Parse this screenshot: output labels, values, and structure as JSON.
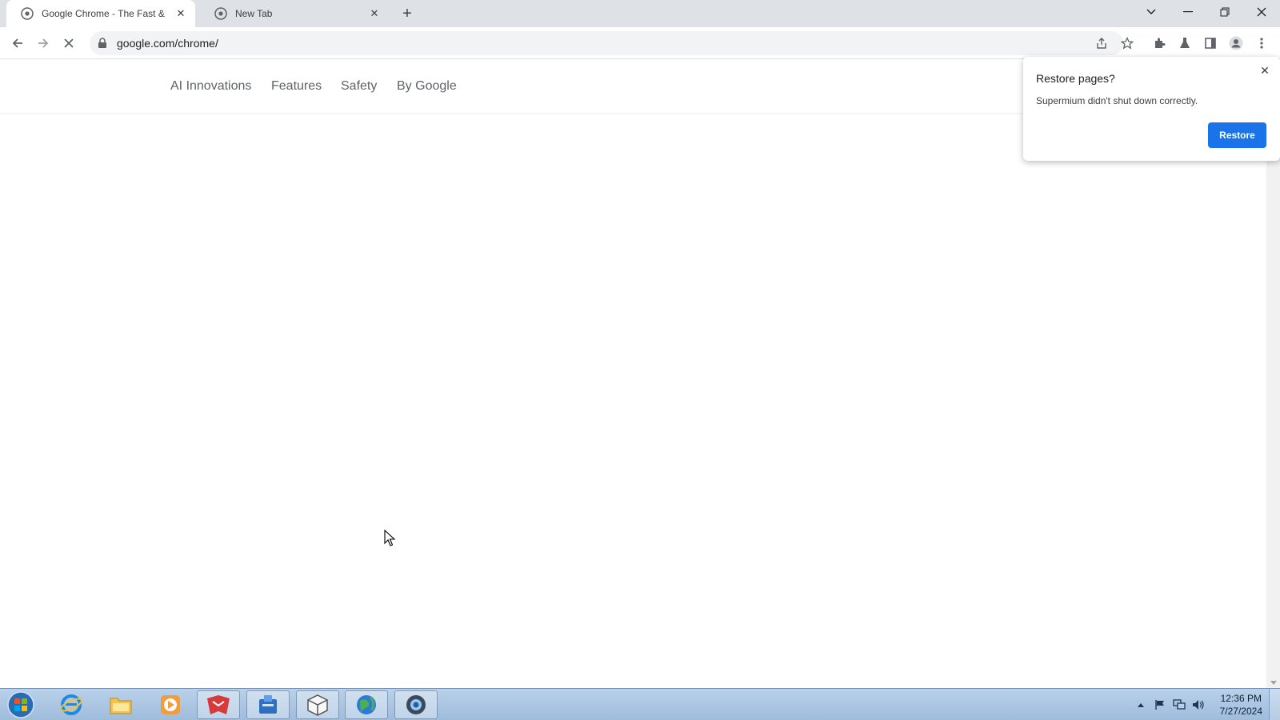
{
  "tabs": [
    {
      "title": "Google Chrome - The Fast & Se",
      "favicon": "chrome-icon",
      "active": true
    },
    {
      "title": "New Tab",
      "favicon": "chrome-icon",
      "active": false
    }
  ],
  "window_controls": [
    "tab-search-icon",
    "minimize-icon",
    "restore-icon",
    "close-icon"
  ],
  "address_bar": {
    "url": "google.com/chrome/"
  },
  "site_nav": {
    "links": [
      "AI Innovations",
      "Features",
      "Safety",
      "By Google"
    ]
  },
  "restore_bubble": {
    "title": "Restore pages?",
    "message": "Supermium didn't shut down correctly.",
    "button": "Restore"
  },
  "taskbar": {
    "apps": [
      "internet-explorer-icon",
      "file-explorer-icon",
      "media-player-icon",
      "app-red-icon",
      "app-blue-icon",
      "app-box-icon",
      "app-globe-icon",
      "supermium-icon"
    ],
    "time": "12:36 PM",
    "date": "7/27/2024"
  },
  "colors": {
    "accent": "#1a73e8",
    "tabstrip": "#dee1e6",
    "taskbar": "#b9d1ea"
  }
}
